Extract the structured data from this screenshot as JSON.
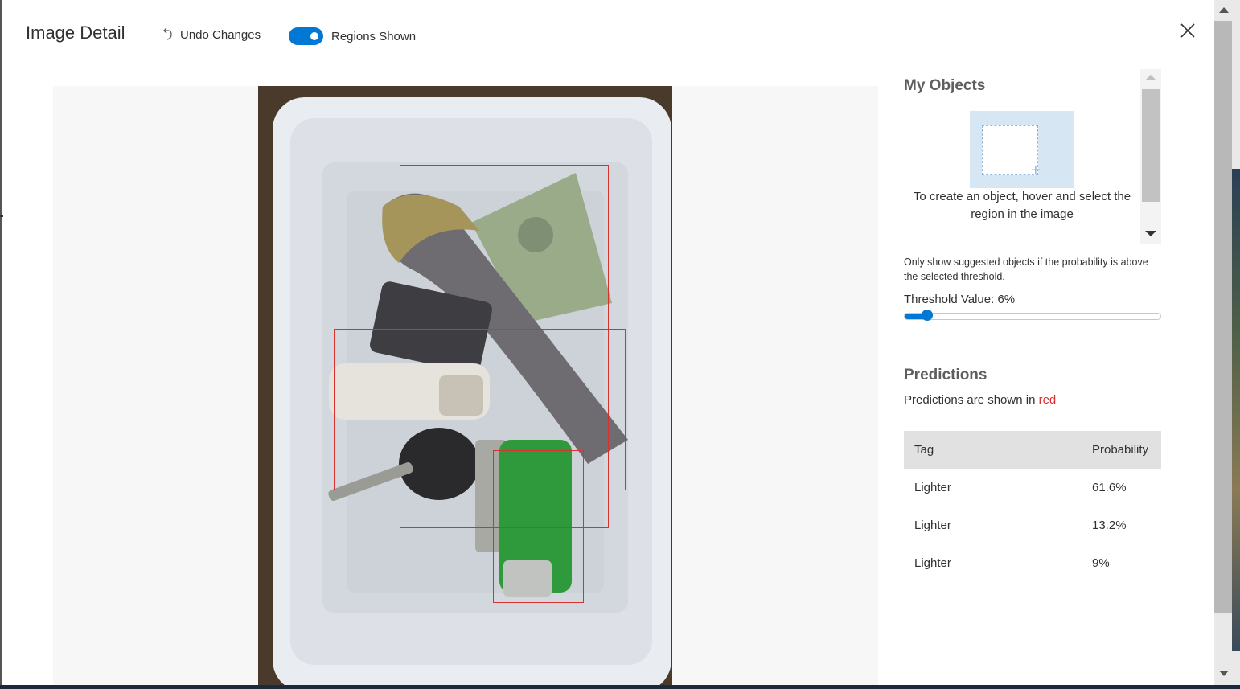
{
  "header": {
    "title": "Image Detail",
    "undo_label": "Undo Changes",
    "regions_label": "Regions Shown",
    "regions_enabled": true
  },
  "my_objects": {
    "title": "My Objects",
    "hint": "To create an object, hover and select the region in the image"
  },
  "threshold": {
    "note": "Only show suggested objects if the probability is above the selected threshold.",
    "label": "Threshold Value: 6%",
    "value_percent": 6
  },
  "predictions": {
    "title": "Predictions",
    "note_prefix": "Predictions are shown in",
    "note_color_word": "red",
    "columns": [
      "Tag",
      "Probability"
    ],
    "rows": [
      {
        "tag": "Lighter",
        "probability": "61.6%"
      },
      {
        "tag": "Lighter",
        "probability": "13.2%"
      },
      {
        "tag": "Lighter",
        "probability": "9%"
      }
    ]
  },
  "colors": {
    "accent": "#0078d4",
    "prediction": "#d93030"
  }
}
